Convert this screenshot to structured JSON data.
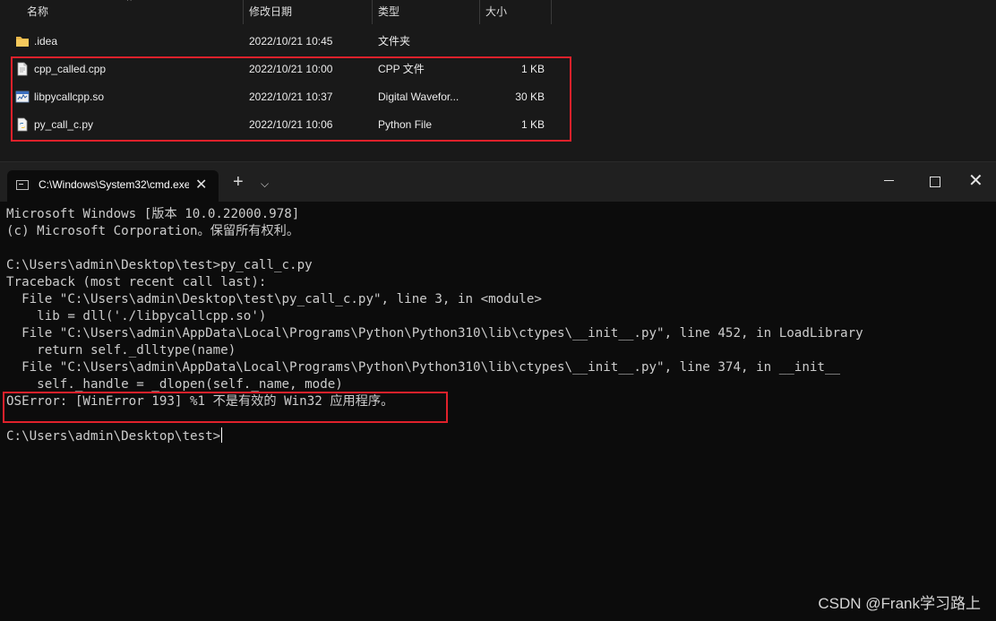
{
  "explorer": {
    "columns": {
      "name": "名称",
      "date": "修改日期",
      "type": "类型",
      "size": "大小"
    },
    "files": [
      {
        "name": ".idea",
        "date": "2022/10/21 10:45",
        "type": "文件夹",
        "size": "",
        "icon": "folder-icon"
      },
      {
        "name": "cpp_called.cpp",
        "date": "2022/10/21 10:00",
        "type": "CPP 文件",
        "size": "1 KB",
        "icon": "cpp-file-icon"
      },
      {
        "name": "libpycallcpp.so",
        "date": "2022/10/21 10:37",
        "type": "Digital Wavefor...",
        "size": "30 KB",
        "icon": "so-file-icon"
      },
      {
        "name": "py_call_c.py",
        "date": "2022/10/21 10:06",
        "type": "Python File",
        "size": "1 KB",
        "icon": "python-file-icon"
      }
    ]
  },
  "terminal": {
    "tab_title": "C:\\Windows\\System32\\cmd.exe",
    "new_tab_symbol": "+",
    "dropdown_symbol": "⌵",
    "close_symbol": "✕",
    "lines": [
      "Microsoft Windows [版本 10.0.22000.978]",
      "(c) Microsoft Corporation。保留所有权利。",
      "",
      "C:\\Users\\admin\\Desktop\\test>py_call_c.py",
      "Traceback (most recent call last):",
      "  File \"C:\\Users\\admin\\Desktop\\test\\py_call_c.py\", line 3, in <module>",
      "    lib = dll('./libpycallcpp.so')",
      "  File \"C:\\Users\\admin\\AppData\\Local\\Programs\\Python\\Python310\\lib\\ctypes\\__init__.py\", line 452, in LoadLibrary",
      "    return self._dlltype(name)",
      "  File \"C:\\Users\\admin\\AppData\\Local\\Programs\\Python\\Python310\\lib\\ctypes\\__init__.py\", line 374, in __init__",
      "    self._handle = _dlopen(self._name, mode)",
      "OSError: [WinError 193] %1 不是有效的 Win32 应用程序。",
      ""
    ],
    "prompt": "C:\\Users\\admin\\Desktop\\test>"
  },
  "watermark": "CSDN @Frank学习路上",
  "colors": {
    "highlight_border": "#e0212b",
    "console_bg": "#0c0c0c",
    "explorer_bg": "#191919",
    "folder": "#e8b64a"
  }
}
